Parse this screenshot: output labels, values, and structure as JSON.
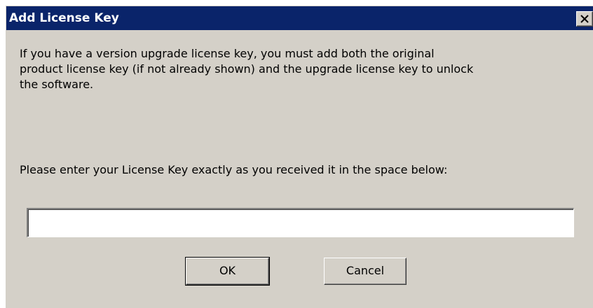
{
  "window": {
    "title": "Add License Key",
    "title_bar_color": "#0a246a",
    "background_color": "#d4d0c8"
  },
  "titlebar": {
    "close_icon": "close-icon"
  },
  "dialog": {
    "info_text": "If you have a version upgrade license key, you must add both the original\nproduct license key (if not already shown) and the upgrade license key to unlock\nthe software.",
    "prompt_text": "Please enter your License Key exactly as you received it in the space below:",
    "license_key_value": "",
    "license_key_placeholder": ""
  },
  "buttons": {
    "ok_label": "OK",
    "cancel_label": "Cancel"
  }
}
